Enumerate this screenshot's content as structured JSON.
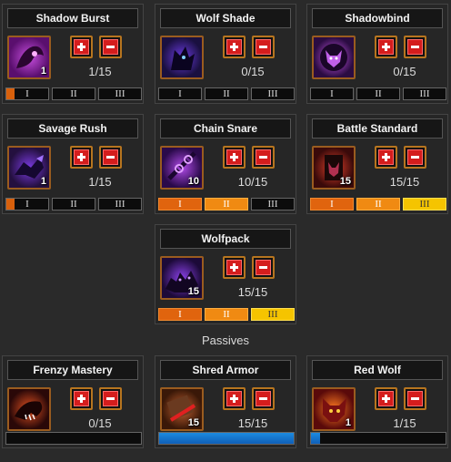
{
  "talents": [
    {
      "name": "Shadow Burst",
      "rank": "1",
      "count": "1/15",
      "tiers": [
        "I",
        "II",
        "III"
      ],
      "tier_state": [
        "partial",
        "off",
        "off"
      ],
      "icon": "shadow-burst-icon",
      "colors": [
        "#5a0f6e",
        "#c84fe0"
      ]
    },
    {
      "name": "Wolf Shade",
      "rank": "",
      "count": "0/15",
      "tiers": [
        "I",
        "II",
        "III"
      ],
      "tier_state": [
        "off",
        "off",
        "off"
      ],
      "icon": "wolf-shade-icon",
      "colors": [
        "#1a1040",
        "#6a3ae0"
      ]
    },
    {
      "name": "Shadowbind",
      "rank": "",
      "count": "0/15",
      "tiers": [
        "I",
        "II",
        "III"
      ],
      "tier_state": [
        "off",
        "off",
        "off"
      ],
      "icon": "shadowbind-wolf-icon",
      "colors": [
        "#2b0c42",
        "#d05af0"
      ]
    },
    {
      "name": "Savage Rush",
      "rank": "1",
      "count": "1/15",
      "tiers": [
        "I",
        "II",
        "III"
      ],
      "tier_state": [
        "partial",
        "off",
        "off"
      ],
      "icon": "savage-rush-icon",
      "colors": [
        "#24103f",
        "#7a3ae0"
      ]
    },
    {
      "name": "Chain Snare",
      "rank": "10",
      "count": "10/15",
      "tiers": [
        "I",
        "II",
        "III"
      ],
      "tier_state": [
        "on1",
        "on2",
        "off"
      ],
      "icon": "chain-snare-icon",
      "colors": [
        "#2a0a4a",
        "#b04ae8"
      ]
    },
    {
      "name": "Battle Standard",
      "rank": "15",
      "count": "15/15",
      "tiers": [
        "I",
        "II",
        "III"
      ],
      "tier_state": [
        "on1",
        "on2",
        "on3"
      ],
      "icon": "battle-standard-icon",
      "colors": [
        "#3a0a0a",
        "#e0402a"
      ]
    },
    {
      "name": "Wolfpack",
      "rank": "15",
      "count": "15/15",
      "tiers": [
        "I",
        "II",
        "III"
      ],
      "tier_state": [
        "on1",
        "on2",
        "on3"
      ],
      "icon": "wolfpack-icon",
      "colors": [
        "#1c0a38",
        "#8a40e8"
      ]
    }
  ],
  "section_label": "Passives",
  "passives": [
    {
      "name": "Frenzy Mastery",
      "rank": "",
      "count": "0/15",
      "progress": 0.0,
      "icon": "frenzy-mastery-icon",
      "colors": [
        "#2a0808",
        "#e05020"
      ]
    },
    {
      "name": "Shred Armor",
      "rank": "15",
      "count": "15/15",
      "progress": 1.0,
      "icon": "shred-armor-icon",
      "colors": [
        "#3a1808",
        "#c06030"
      ]
    },
    {
      "name": "Red Wolf",
      "rank": "1",
      "count": "1/15",
      "progress": 0.0667,
      "icon": "red-wolf-icon",
      "colors": [
        "#5a0a0a",
        "#ff7a20"
      ]
    }
  ]
}
